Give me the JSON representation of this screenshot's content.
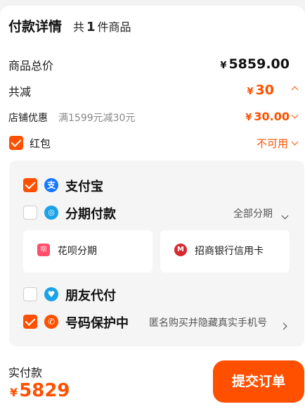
{
  "header": {
    "title": "付款详情",
    "count_prefix": "共",
    "count": "1",
    "count_suffix": "件商品"
  },
  "summary": {
    "total_label": "商品总价",
    "total_currency": "¥",
    "total_value": "5859.00",
    "discount_label": "共减",
    "discount_currency": "¥",
    "discount_value": "30",
    "shop_label": "店铺优惠",
    "shop_rule": "满1599元减30元",
    "shop_currency": "¥",
    "shop_value": "30.00",
    "redpacket_label": "红包",
    "redpacket_status": "不可用"
  },
  "payment": {
    "alipay": {
      "label": "支付宝",
      "checked": true,
      "icon": "alipay-icon"
    },
    "installment": {
      "label": "分期付款",
      "checked": false,
      "icon": "installment-icon",
      "option": "全部分期"
    },
    "installment_options": [
      {
        "label": "花呗分期",
        "icon": "huabei-icon"
      },
      {
        "label": "招商银行信用卡",
        "icon": "cmb-bank-icon"
      }
    ],
    "friend": {
      "label": "朋友代付",
      "checked": false,
      "icon": "friend-pay-icon"
    },
    "privacy": {
      "label": "号码保护中",
      "checked": true,
      "icon": "phone-protect-icon",
      "desc": "匿名购买并隐藏真实手机号"
    }
  },
  "footer": {
    "paid_label": "实付款",
    "paid_currency": "¥",
    "paid_value": "5829",
    "submit_label": "提交订单"
  },
  "colors": {
    "accent": "#ff5000",
    "alipay": "#1677ff",
    "installment": "#1aa3e8"
  }
}
